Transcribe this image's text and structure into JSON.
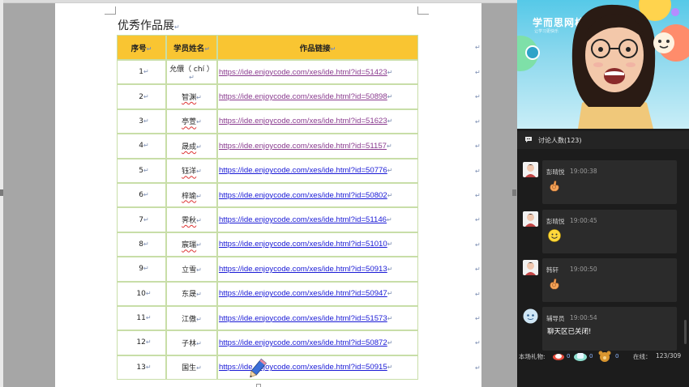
{
  "document": {
    "heading": "优秀作品展",
    "paragraph_mark": "↵",
    "table": {
      "headers": [
        "序号",
        "学员姓名",
        "作品链接"
      ],
      "rows": [
        {
          "num": "1",
          "name": "允儇（ chí ）",
          "link": "https://ide.enjoycode.com/xes/ide.html?id=51423",
          "visited": true
        },
        {
          "num": "2",
          "name": "智渊",
          "link": "https://ide.enjoycode.com/xes/ide.html?id=50898",
          "visited": true
        },
        {
          "num": "3",
          "name": "亭萱",
          "link": "https://ide.enjoycode.com/xes/ide.html?id=51623",
          "visited": true
        },
        {
          "num": "4",
          "name": "晟成",
          "link": "https://ide.enjoycode.com/xes/ide.html?id=51157",
          "visited": true
        },
        {
          "num": "5",
          "name": "钰洋",
          "link": "https://ide.enjoycode.com/xes/ide.html?id=50776",
          "visited": false
        },
        {
          "num": "6",
          "name": "梓瑜",
          "link": "https://ide.enjoycode.com/xes/ide.html?id=50802",
          "visited": false
        },
        {
          "num": "7",
          "name": "霁秋",
          "link": "https://ide.enjoycode.com/xes/ide.html?id=51146",
          "visited": false
        },
        {
          "num": "8",
          "name": "宸瑞",
          "link": "https://ide.enjoycode.com/xes/ide.html?id=51010",
          "visited": false
        },
        {
          "num": "9",
          "name": "立雪",
          "link": "https://ide.enjoycode.com/xes/ide.html?id=50913",
          "visited": false
        },
        {
          "num": "10",
          "name": "东晟",
          "link": "https://ide.enjoycode.com/xes/ide.html?id=50947",
          "visited": false
        },
        {
          "num": "11",
          "name": "江傲",
          "link": "https://ide.enjoycode.com/xes/ide.html?id=51573",
          "visited": false
        },
        {
          "num": "12",
          "name": "子林",
          "link": "https://ide.enjoycode.com/xes/ide.html?id=50872",
          "visited": false
        },
        {
          "num": "13",
          "name": "国生",
          "link": "https://ide.enjoycode.com/xes/ide.html?id=50915",
          "visited": false
        }
      ]
    }
  },
  "video": {
    "logo": "学而思网校",
    "logo_sub": "让学习更快乐"
  },
  "chat": {
    "header_label": "讨论人数(123)",
    "messages": [
      {
        "name": "彭晴悦",
        "time": "19:00:38",
        "body": "",
        "emoji": "ok-hand-icon"
      },
      {
        "name": "彭晴悦",
        "time": "19:00:45",
        "body": "",
        "emoji": "smiley-icon"
      },
      {
        "name": "韩轩",
        "time": "19:00:50",
        "body": "",
        "emoji": "ok-hand-icon"
      },
      {
        "name": "辅导员",
        "time": "19:00:54",
        "body": "聊天区已关闭!",
        "emoji": ""
      }
    ]
  },
  "footer": {
    "gift_label": "本场礼物:",
    "gift_counts": [
      "0",
      "0",
      "0"
    ],
    "online_label": "在线：",
    "online_value": "123/309"
  },
  "colors": {
    "header_fill": "#f9c532",
    "visited_link": "#8a3b8f",
    "link": "#1a1ad6",
    "panel_bg": "#1c1c1c"
  }
}
